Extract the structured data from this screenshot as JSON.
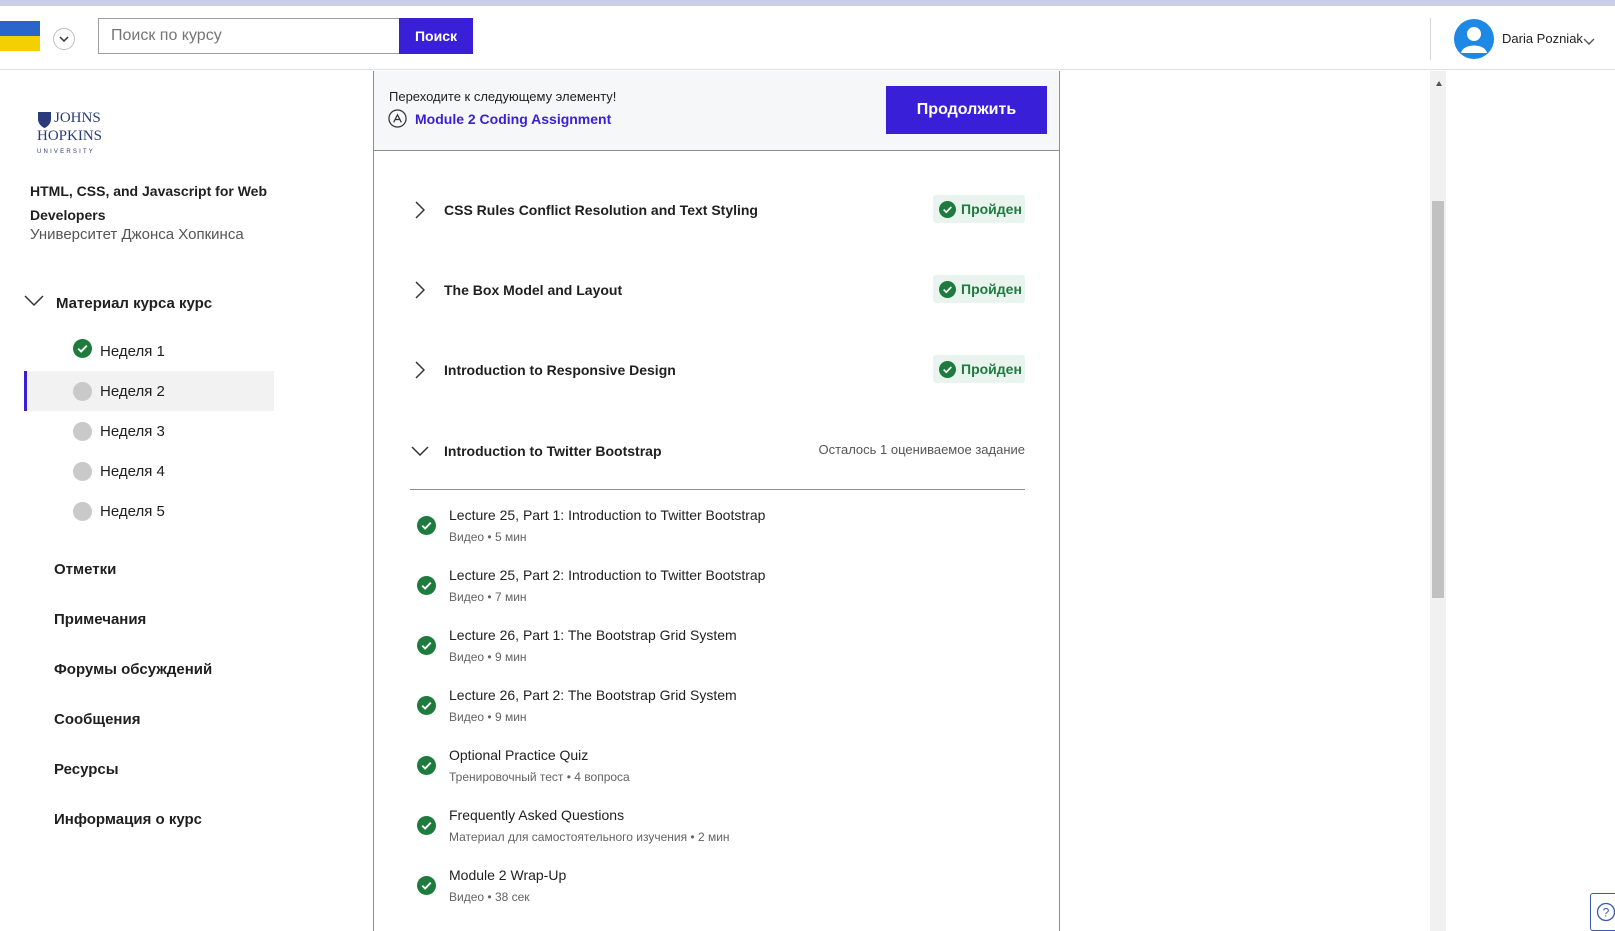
{
  "colors": {
    "accent": "#3a1fd8",
    "success": "#1f7a3e",
    "success_bg": "#e9f4ee",
    "muted": "#c9c9c9"
  },
  "header": {
    "search": {
      "placeholder": "Поиск по курсу",
      "button_label": "Поиск"
    },
    "user": {
      "name": "Daria Pozniak"
    }
  },
  "sidebar": {
    "logo_text": [
      "JOHNS",
      "HOPKINS",
      "UNIVERSITY"
    ],
    "course_title": "HTML, CSS, and Javascript for Web Developers",
    "course_org": "Университет Джонса Хопкинса",
    "material_label": "Материал курса курс",
    "weeks": [
      {
        "label": "Неделя 1",
        "status": "completed"
      },
      {
        "label": "Неделя 2",
        "status": "active"
      },
      {
        "label": "Неделя 3",
        "status": "pending"
      },
      {
        "label": "Неделя 4",
        "status": "pending"
      },
      {
        "label": "Неделя 5",
        "status": "pending"
      }
    ],
    "nav": [
      {
        "label": "Отметки"
      },
      {
        "label": "Примечания"
      },
      {
        "label": "Форумы обсуждений"
      },
      {
        "label": "Сообщения"
      },
      {
        "label": "Ресурсы"
      },
      {
        "label": "Информация о курс"
      }
    ]
  },
  "next_banner": {
    "prompt": "Переходите к следующему элементу!",
    "link_label": "Module 2 Coding Assignment",
    "continue_label": "Продолжить"
  },
  "lessons": [
    {
      "title": "CSS Rules Conflict Resolution and Text Styling",
      "status": "Пройден",
      "expanded": false
    },
    {
      "title": "The Box Model and Layout",
      "status": "Пройден",
      "expanded": false
    },
    {
      "title": "Introduction to Responsive Design",
      "status": "Пройден",
      "expanded": false
    },
    {
      "title": "Introduction to Twitter Bootstrap",
      "remaining": "Осталось 1 оцениваемое задание",
      "expanded": true
    }
  ],
  "items": [
    {
      "name": "Lecture 25, Part 1: Introduction to Twitter Bootstrap",
      "type": "Видео",
      "detail": "5 мин"
    },
    {
      "name": "Lecture 25, Part 2: Introduction to Twitter Bootstrap",
      "type": "Видео",
      "detail": "7 мин"
    },
    {
      "name": "Lecture 26, Part 1: The Bootstrap Grid System",
      "type": "Видео",
      "detail": "9 мин"
    },
    {
      "name": "Lecture 26, Part 2: The Bootstrap Grid System",
      "type": "Видео",
      "detail": "9 мин"
    },
    {
      "name": "Optional Practice Quiz",
      "type": "Тренировочный тест",
      "detail": "4 вопроса"
    },
    {
      "name": "Frequently Asked Questions",
      "type": "Материал для самостоятельного изучения",
      "detail": "2 мин"
    },
    {
      "name": "Module 2 Wrap-Up",
      "type": "Видео",
      "detail": "38 сек"
    }
  ],
  "help_label": "?"
}
